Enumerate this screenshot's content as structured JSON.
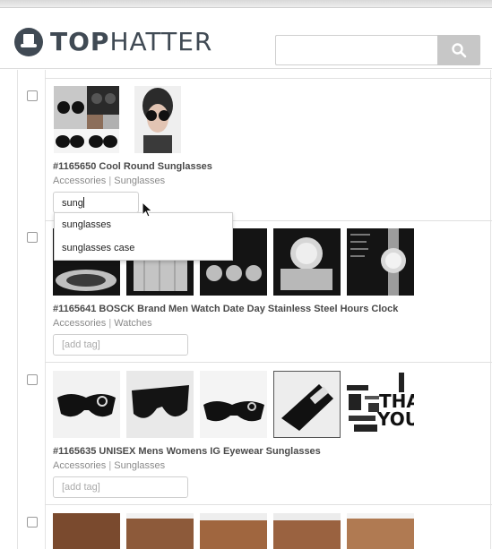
{
  "brand": {
    "top": "TOP",
    "hatter": "HATTER"
  },
  "search": {
    "value": "",
    "placeholder": ""
  },
  "products": [
    {
      "number": "#1165650",
      "name": "Cool Round Sunglasses",
      "category": "Accessories",
      "subcategory": "Sunglasses",
      "tag_value": "sung",
      "tag_placeholder": "[add tag]"
    },
    {
      "number": "#1165641",
      "name": "BOSCK Brand Men Watch Date Day Stainless Steel Hours Clock",
      "category": "Accessories",
      "subcategory": "Watches",
      "tag_placeholder": "[add tag]"
    },
    {
      "number": "#1165635",
      "name": "UNISEX Mens Womens IG Eyewear Sunglasses",
      "category": "Accessories",
      "subcategory": "Sunglasses",
      "tag_placeholder": "[add tag]"
    }
  ],
  "separator": "|",
  "autocomplete": [
    "sunglasses",
    "sunglasses case"
  ],
  "thank_you_text": {
    "line1": "THA",
    "line2": "YOU"
  }
}
